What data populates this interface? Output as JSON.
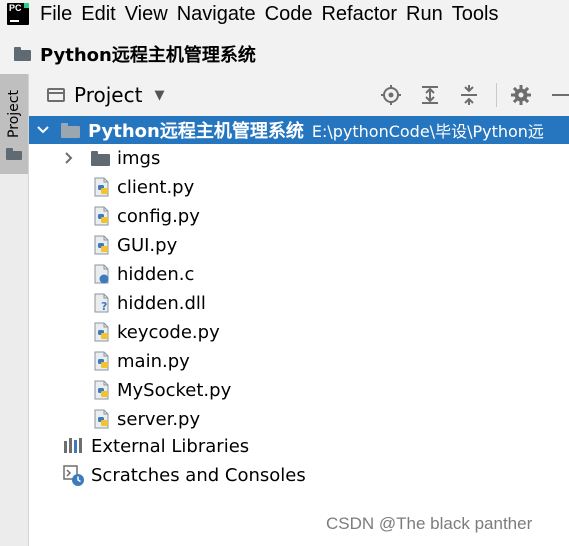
{
  "menubar": {
    "items": [
      "File",
      "Edit",
      "View",
      "Navigate",
      "Code",
      "Refactor",
      "Run",
      "Tools"
    ]
  },
  "breadcrumb": {
    "project_name": "Python远程主机管理系统"
  },
  "side_strip": {
    "tab_label": "Project"
  },
  "panel": {
    "title": "Project",
    "tools": [
      "locate-icon",
      "expand-all-icon",
      "collapse-all-icon",
      "gear-icon",
      "minimize-icon"
    ]
  },
  "tree": {
    "root": {
      "name": "Python远程主机管理系统",
      "path": "E:\\pythonCode\\毕设\\Python远"
    },
    "folders": [
      {
        "name": "imgs"
      }
    ],
    "files": [
      {
        "name": "client.py",
        "icon": "python-file-icon"
      },
      {
        "name": "config.py",
        "icon": "python-file-icon"
      },
      {
        "name": "GUI.py",
        "icon": "python-file-icon"
      },
      {
        "name": "hidden.c",
        "icon": "c-file-icon"
      },
      {
        "name": "hidden.dll",
        "icon": "unknown-file-icon"
      },
      {
        "name": "keycode.py",
        "icon": "python-file-icon"
      },
      {
        "name": "main.py",
        "icon": "python-file-icon"
      },
      {
        "name": "MySocket.py",
        "icon": "python-file-icon"
      },
      {
        "name": "server.py",
        "icon": "python-file-icon"
      }
    ],
    "external_libraries": "External Libraries",
    "scratches": "Scratches and Consoles"
  },
  "watermark": "CSDN @The black panther",
  "colors": {
    "selection": "#2675bf",
    "python_blue": "#3e7bbd",
    "python_yellow": "#f1c232",
    "folder": "#5f6a72"
  }
}
